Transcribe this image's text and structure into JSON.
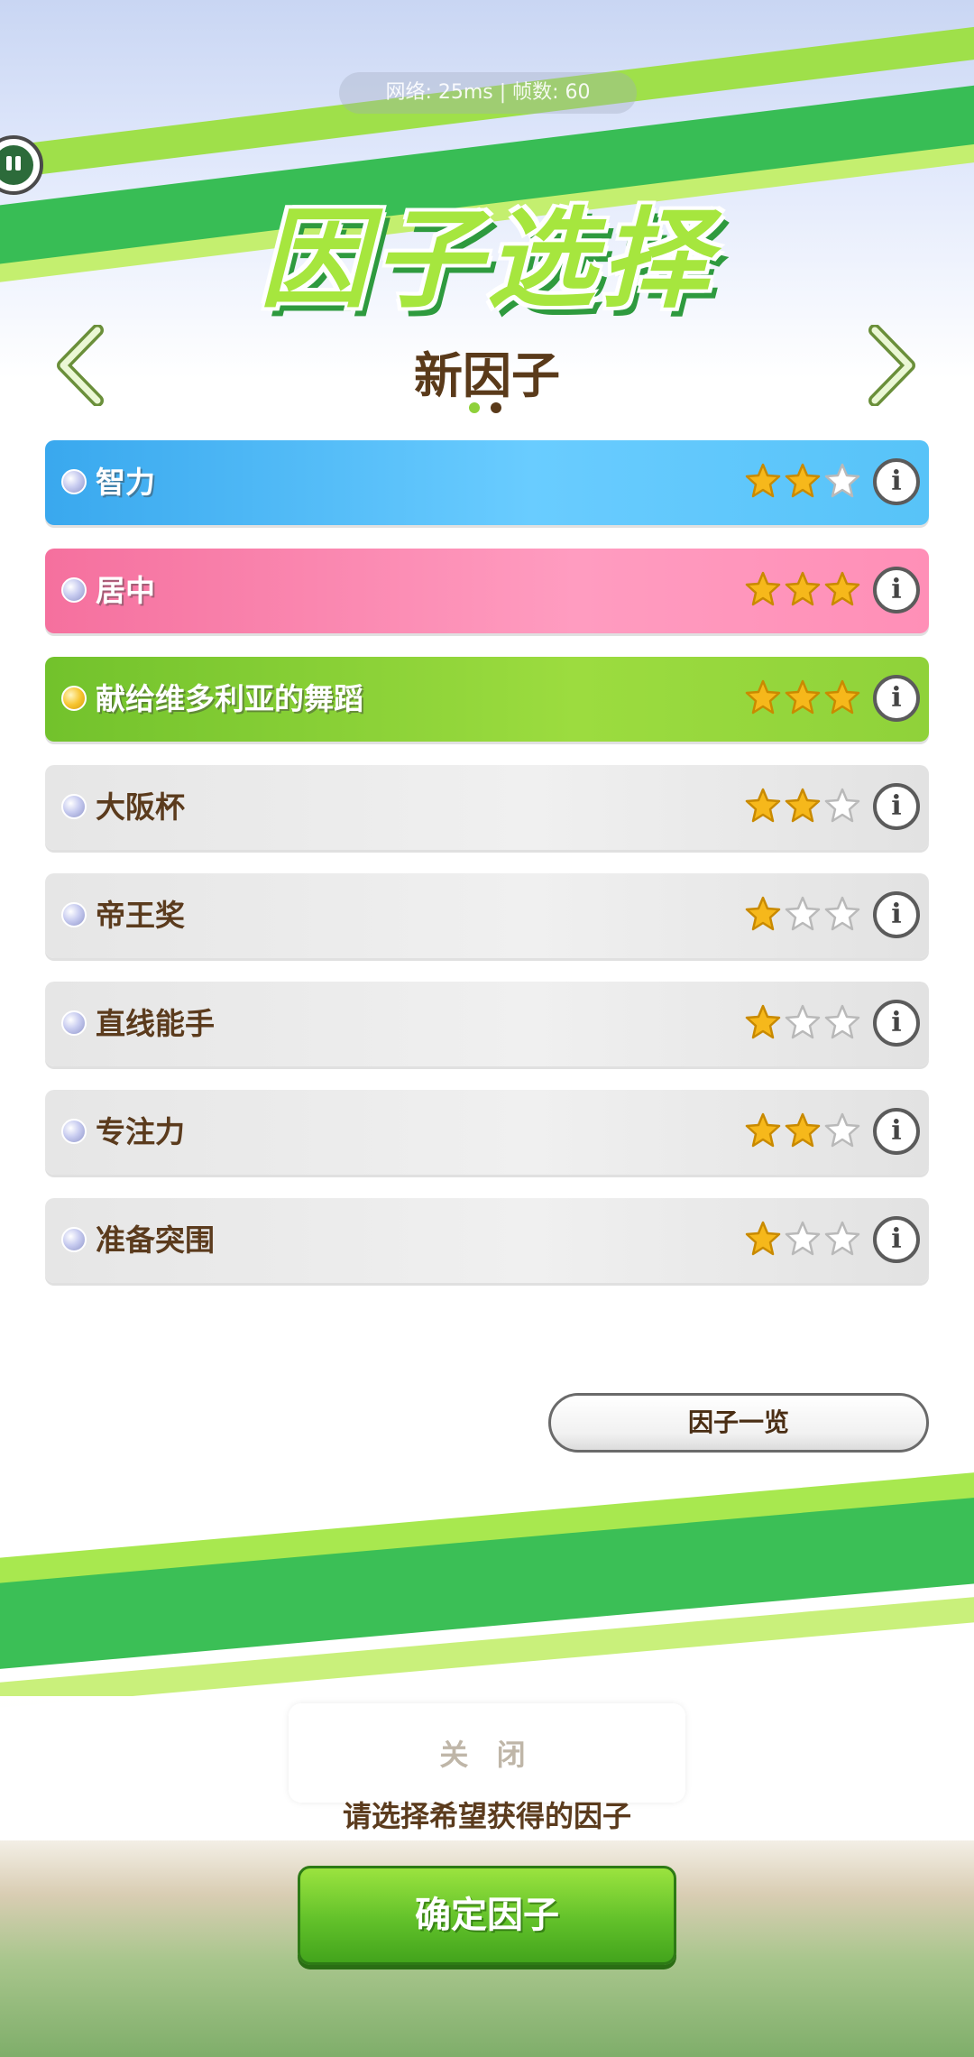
{
  "status": {
    "text": "网络: 25ms | 帧数: 60"
  },
  "header": {
    "title": "因子选择",
    "subtitle": "新因子"
  },
  "pager": {
    "current": 1,
    "total": 2
  },
  "factors": [
    {
      "name": "智力",
      "stars": 2,
      "max_stars": 3,
      "color": "blue",
      "gem": "silver"
    },
    {
      "name": "居中",
      "stars": 3,
      "max_stars": 3,
      "color": "pink",
      "gem": "silver"
    },
    {
      "name": "献给维多利亚的舞蹈",
      "stars": 3,
      "max_stars": 3,
      "color": "green",
      "gem": "gold"
    },
    {
      "name": "大阪杯",
      "stars": 2,
      "max_stars": 3,
      "color": "gray",
      "gem": "silver"
    },
    {
      "name": "帝王奖",
      "stars": 1,
      "max_stars": 3,
      "color": "gray",
      "gem": "silver"
    },
    {
      "name": "直线能手",
      "stars": 1,
      "max_stars": 3,
      "color": "gray",
      "gem": "silver"
    },
    {
      "name": "专注力",
      "stars": 2,
      "max_stars": 3,
      "color": "gray",
      "gem": "silver"
    },
    {
      "name": "准备突围",
      "stars": 1,
      "max_stars": 3,
      "color": "gray",
      "gem": "silver"
    }
  ],
  "info_glyph": "i",
  "buttons": {
    "factor_list": "因子一览",
    "cancel": "关 闭",
    "confirm": "确定因子"
  },
  "hint": "请选择希望获得的因子",
  "colors": {
    "blue": "#4fb8f5",
    "pink": "#ff8fb7",
    "green": "#8fd23a",
    "gray": "#e8e8e8",
    "brown_text": "#5b3b1d",
    "star_gold": "#f6b81b"
  }
}
